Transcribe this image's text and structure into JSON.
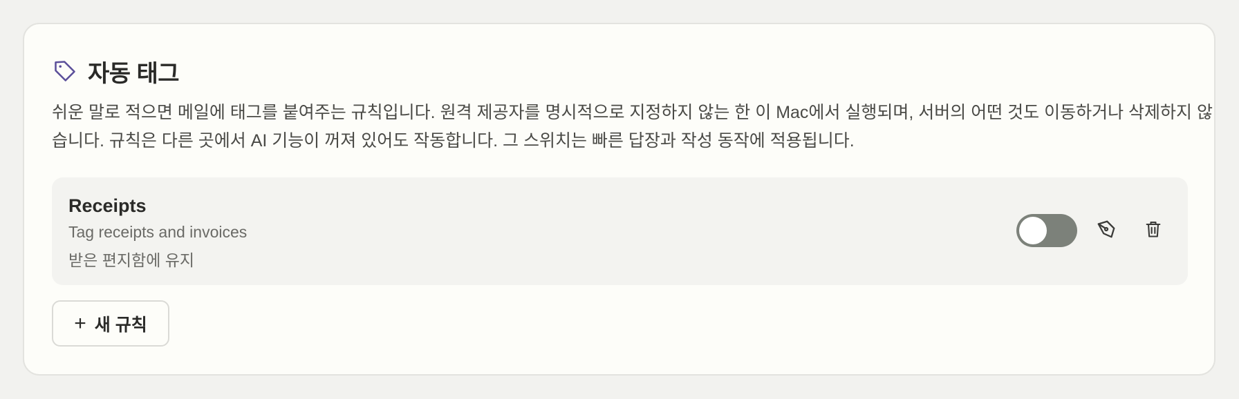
{
  "section": {
    "icon": "tag-icon",
    "title": "자동 태그",
    "description": "쉬운 말로 적으면 메일에 태그를 붙여주는 규칙입니다. 원격 제공자를 명시적으로 지정하지 않는 한 이 Mac에서 실행되며, 서버의 어떤 것도 이동하거나 삭제하지 않습니다. 규칙은 다른 곳에서 AI 기능이 꺼져 있어도 작동합니다. 그 스위치는 빠른 답장과 작성 동작에 적용됩니다."
  },
  "rules": [
    {
      "name": "Receipts",
      "description": "Tag receipts and invoices",
      "action": "받은 편지함에 유지",
      "enabled": false,
      "edit_icon": "pen-icon",
      "delete_icon": "trash-icon"
    }
  ],
  "new_rule_button": {
    "icon": "plus-icon",
    "label": "새 규칙"
  },
  "colors": {
    "accent": "#5b4f9a",
    "toggle_off": "#7c817a",
    "card_bg": "#fdfdf9",
    "page_bg": "#f2f2ef"
  }
}
